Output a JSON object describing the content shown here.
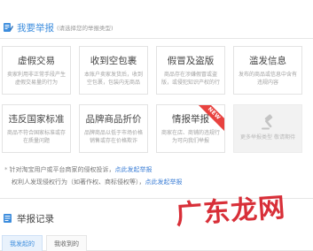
{
  "header": {
    "title": "我要举报",
    "subtitle": "(请选择您的举报类型)"
  },
  "cards": [
    {
      "title": "虚假交易",
      "desc": "卖家利用非正常手段产生虚假交易量的行为"
    },
    {
      "title": "收到空包裹",
      "desc": "本账户卖家发货后，收到空包裹，包装内无商品"
    },
    {
      "title": "假冒及盗版",
      "desc": "商品存在涉嫌假冒或盗版，或侵犯知识产权的行为"
    },
    {
      "title": "滥发信息",
      "desc": "发布的商品或信息中含有违规内容"
    },
    {
      "title": "违反国家标准",
      "desc": "商品不符合国家标准或存在质量问题"
    },
    {
      "title": "品牌商品折价",
      "desc": "品牌商品以低于市场价格销售或存在价格欺诈"
    },
    {
      "title": "情报举报",
      "desc": "商家在店、商铺的违规行为可向我们举报"
    },
    {
      "title": "",
      "desc": "更多举报类型 敬请期待"
    }
  ],
  "new_badge": "NEW",
  "notices": [
    {
      "star": "*",
      "text": "针对淘宝用户或平台商家的侵权投诉，",
      "link": "点此发起举报"
    },
    {
      "star": "",
      "text": "权利人发现侵权行为（如著作权、商标侵权等），",
      "link": "点此发起举报"
    }
  ],
  "records": {
    "title": "举报记录",
    "tabs": [
      {
        "label": "我发起的",
        "active": true
      },
      {
        "label": "我收到的",
        "active": false
      }
    ]
  },
  "watermark": "广东龙网",
  "colors": {
    "accent": "#3d8ddd",
    "link": "#3d7fd6",
    "badge": "#e8423f",
    "watermark": "#d6242e"
  },
  "icons": {
    "header": "report-icon",
    "records": "record-icon",
    "disabled_card": "gavel-icon"
  }
}
